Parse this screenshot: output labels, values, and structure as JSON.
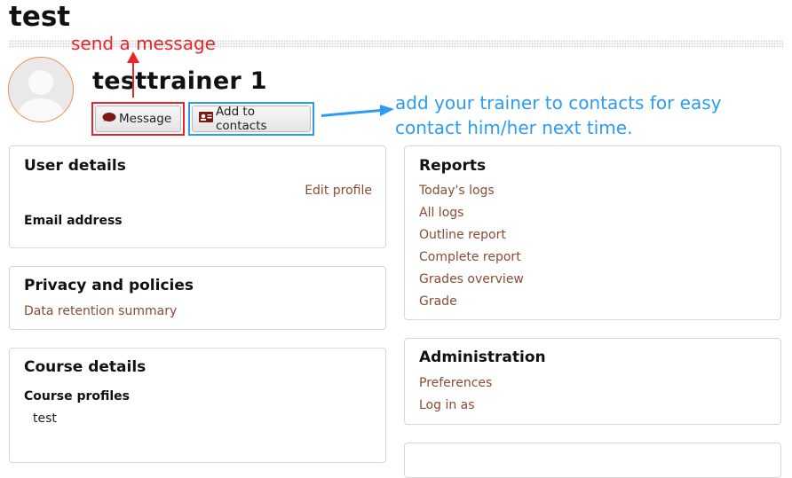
{
  "page": {
    "title": "test"
  },
  "profile": {
    "name": "testtrainer 1",
    "message_label": "Message",
    "add_contacts_label": "Add to contacts"
  },
  "annotations": {
    "send_message": "send a message",
    "add_contacts": "add your trainer to contacts for easy contact him/her next time.",
    "red_color": "#e8262a",
    "blue_color": "#2b9cf2"
  },
  "user_details": {
    "title": "User details",
    "edit_profile": "Edit profile",
    "email_label": "Email address"
  },
  "privacy": {
    "title": "Privacy and policies",
    "link": "Data retention summary"
  },
  "course_details": {
    "title": "Course details",
    "profiles_label": "Course profiles",
    "courses": [
      "test"
    ]
  },
  "reports": {
    "title": "Reports",
    "links": [
      "Today's logs",
      "All logs",
      "Outline report",
      "Complete report",
      "Grades overview",
      "Grade"
    ]
  },
  "administration": {
    "title": "Administration",
    "links": [
      "Preferences",
      "Log in as"
    ]
  },
  "colors": {
    "link": "#8a4b34",
    "avatar_border": "#f08a4b"
  }
}
